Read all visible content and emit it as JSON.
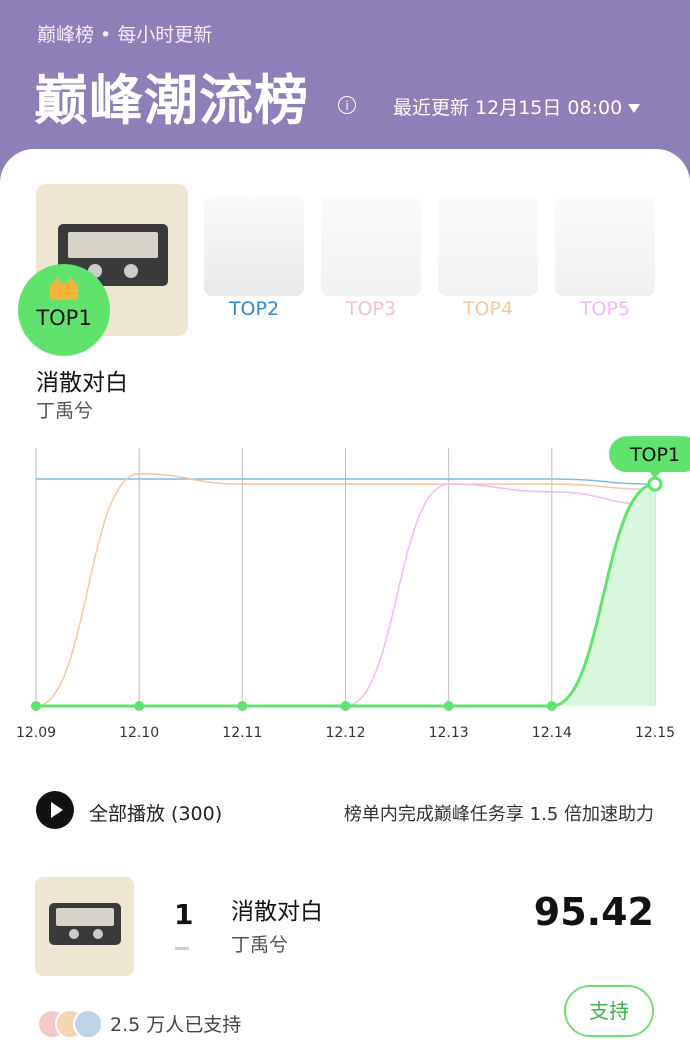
{
  "header": {
    "subtitle": "巅峰榜",
    "subtitle_sep": "•",
    "subtitle_freq": "每小时更新",
    "title": "巅峰潮流榜",
    "info_icon": "info-icon",
    "update_text": "最近更新 12月15日 08:00"
  },
  "top_ranks": {
    "top1": {
      "badge": "TOP1",
      "title": "消散对白",
      "artist": "丁禹兮"
    },
    "others": [
      {
        "label": "TOP2",
        "color": "#2d8ad6"
      },
      {
        "label": "TOP3",
        "color": "#f4c0cc"
      },
      {
        "label": "TOP4",
        "color": "#f3c9a2"
      },
      {
        "label": "TOP5",
        "color": "#f2b8f4"
      }
    ]
  },
  "chart_data": {
    "type": "line",
    "x": [
      "12.09",
      "12.10",
      "12.11",
      "12.12",
      "12.13",
      "12.14",
      "12.15"
    ],
    "ylim": [
      0,
      100
    ],
    "series": [
      {
        "color": "#7fb8e6",
        "values": [
          88,
          88,
          88,
          88,
          88,
          88,
          86
        ]
      },
      {
        "color": "#f3c79e",
        "values": [
          0,
          90,
          86,
          86,
          86,
          86,
          84
        ]
      },
      {
        "color": "#f2b8f4",
        "values": [
          null,
          null,
          null,
          0,
          86,
          83,
          78
        ]
      },
      {
        "color": "#5fe36d",
        "values": [
          0,
          0,
          0,
          0,
          0,
          0,
          86
        ]
      }
    ],
    "annotation": "TOP1",
    "grid": "vertical"
  },
  "controls": {
    "play_all": "全部播放 (300)",
    "promo": "榜单内完成巅峰任务享 1.5 倍加速助力"
  },
  "list": [
    {
      "rank": "1",
      "title": "消散对白",
      "artist": "丁禹兮",
      "score": "95.42"
    }
  ],
  "support": {
    "count_text": "2.5 万人已支持",
    "button": "支持"
  }
}
